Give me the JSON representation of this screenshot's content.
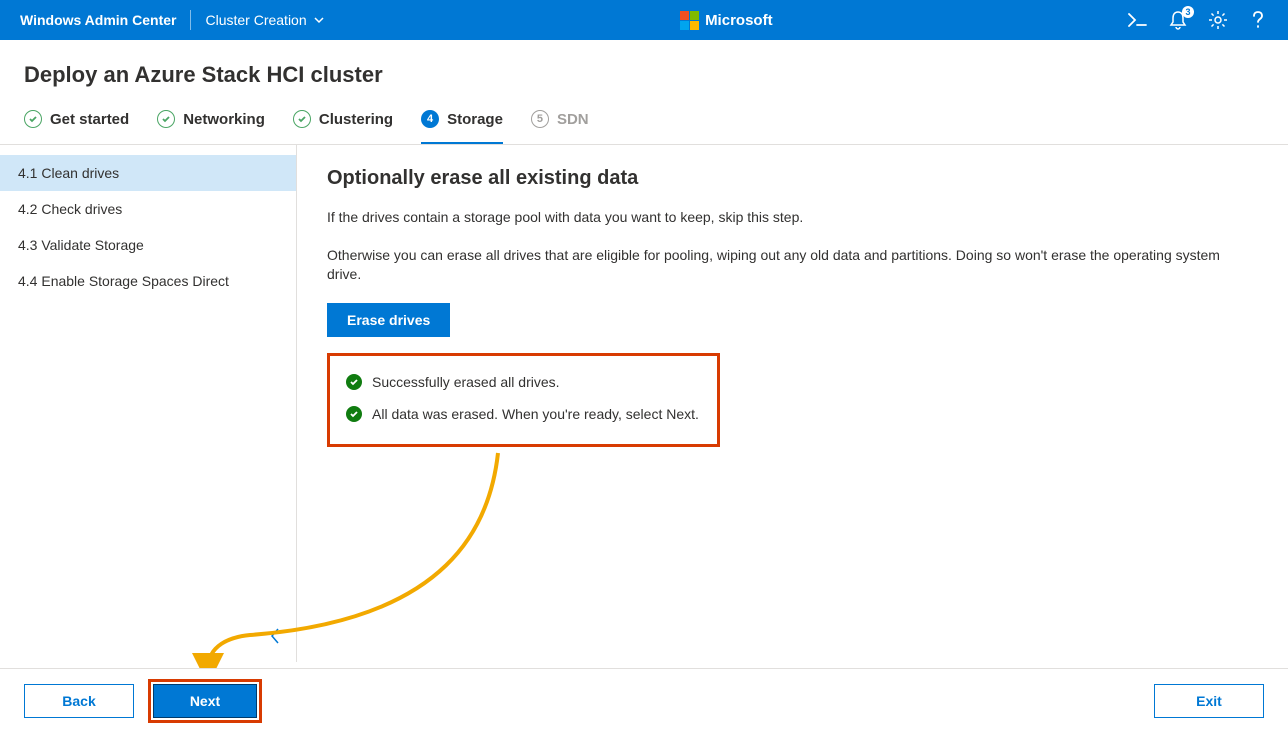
{
  "topbar": {
    "title": "Windows Admin Center",
    "context": "Cluster Creation",
    "brand": "Microsoft",
    "notification_count": "3"
  },
  "page_title": "Deploy an Azure Stack HCI cluster",
  "wizard": [
    {
      "num": "✓",
      "label": "Get started",
      "state": "done"
    },
    {
      "num": "✓",
      "label": "Networking",
      "state": "done"
    },
    {
      "num": "✓",
      "label": "Clustering",
      "state": "done"
    },
    {
      "num": "4",
      "label": "Storage",
      "state": "active"
    },
    {
      "num": "5",
      "label": "SDN",
      "state": "inactive"
    }
  ],
  "sidebar": [
    {
      "label": "4.1  Clean drives",
      "selected": true
    },
    {
      "label": "4.2  Check drives",
      "selected": false
    },
    {
      "label": "4.3  Validate Storage",
      "selected": false
    },
    {
      "label": "4.4  Enable Storage Spaces Direct",
      "selected": false
    }
  ],
  "content": {
    "heading": "Optionally erase all existing data",
    "p1": "If the drives contain a storage pool with data you want to keep, skip this step.",
    "p2": "Otherwise you can erase all drives that are eligible for pooling, wiping out any old data and partitions. Doing so won't erase the operating system drive.",
    "erase_btn": "Erase drives",
    "status1": "Successfully erased all drives.",
    "status2": "All data was erased. When you're ready, select Next."
  },
  "footer": {
    "back": "Back",
    "next": "Next",
    "exit": "Exit"
  }
}
